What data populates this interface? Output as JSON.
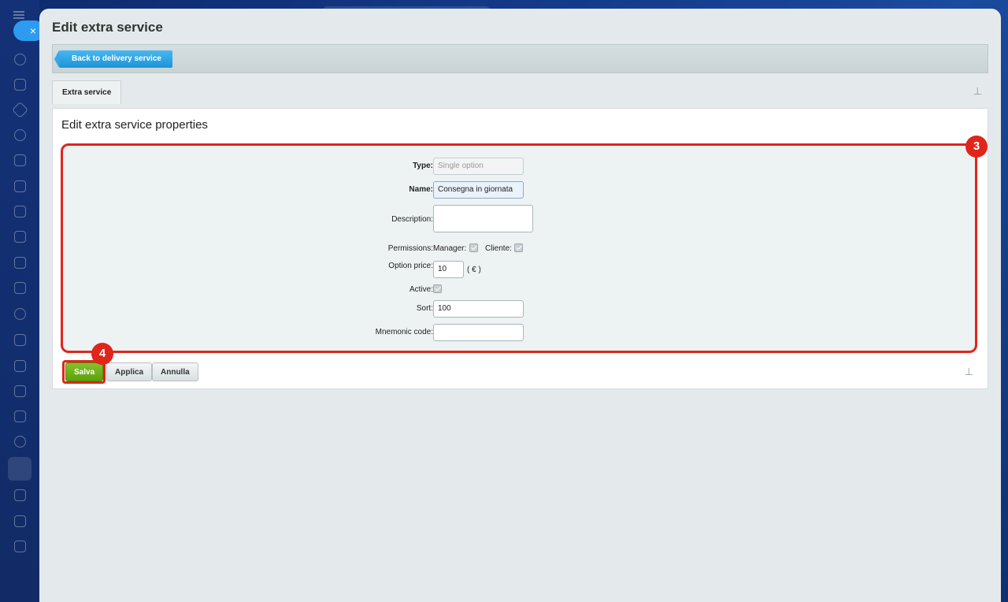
{
  "app": {
    "close_icon": "close-icon"
  },
  "page": {
    "title": "Edit extra service"
  },
  "toolbar": {
    "back_label": "Back to delivery service"
  },
  "tabs": [
    {
      "label": "Extra service"
    }
  ],
  "panel": {
    "title": "Edit extra service properties"
  },
  "form": {
    "type": {
      "label": "Type:",
      "value": "Single option"
    },
    "name": {
      "label": "Name:",
      "value": "Consegna in giornata"
    },
    "description": {
      "label": "Description:",
      "value": ""
    },
    "permissions": {
      "label": "Permissions:",
      "manager_label": "Manager:",
      "manager_checked": true,
      "client_label": "Cliente:",
      "client_checked": true
    },
    "option_price": {
      "label": "Option price:",
      "value": "10",
      "unit": "( € )"
    },
    "active": {
      "label": "Active:",
      "checked": true
    },
    "sort": {
      "label": "Sort:",
      "value": "100"
    },
    "mnemonic": {
      "label": "Mnemonic code:",
      "value": ""
    }
  },
  "buttons": {
    "save": "Salva",
    "apply": "Applica",
    "cancel": "Annulla"
  },
  "annotations": {
    "badge_form": "3",
    "badge_save": "4"
  },
  "colors": {
    "accent": "#e0251b",
    "save_green": "#6aad16",
    "back_blue": "#2d9cf0"
  }
}
